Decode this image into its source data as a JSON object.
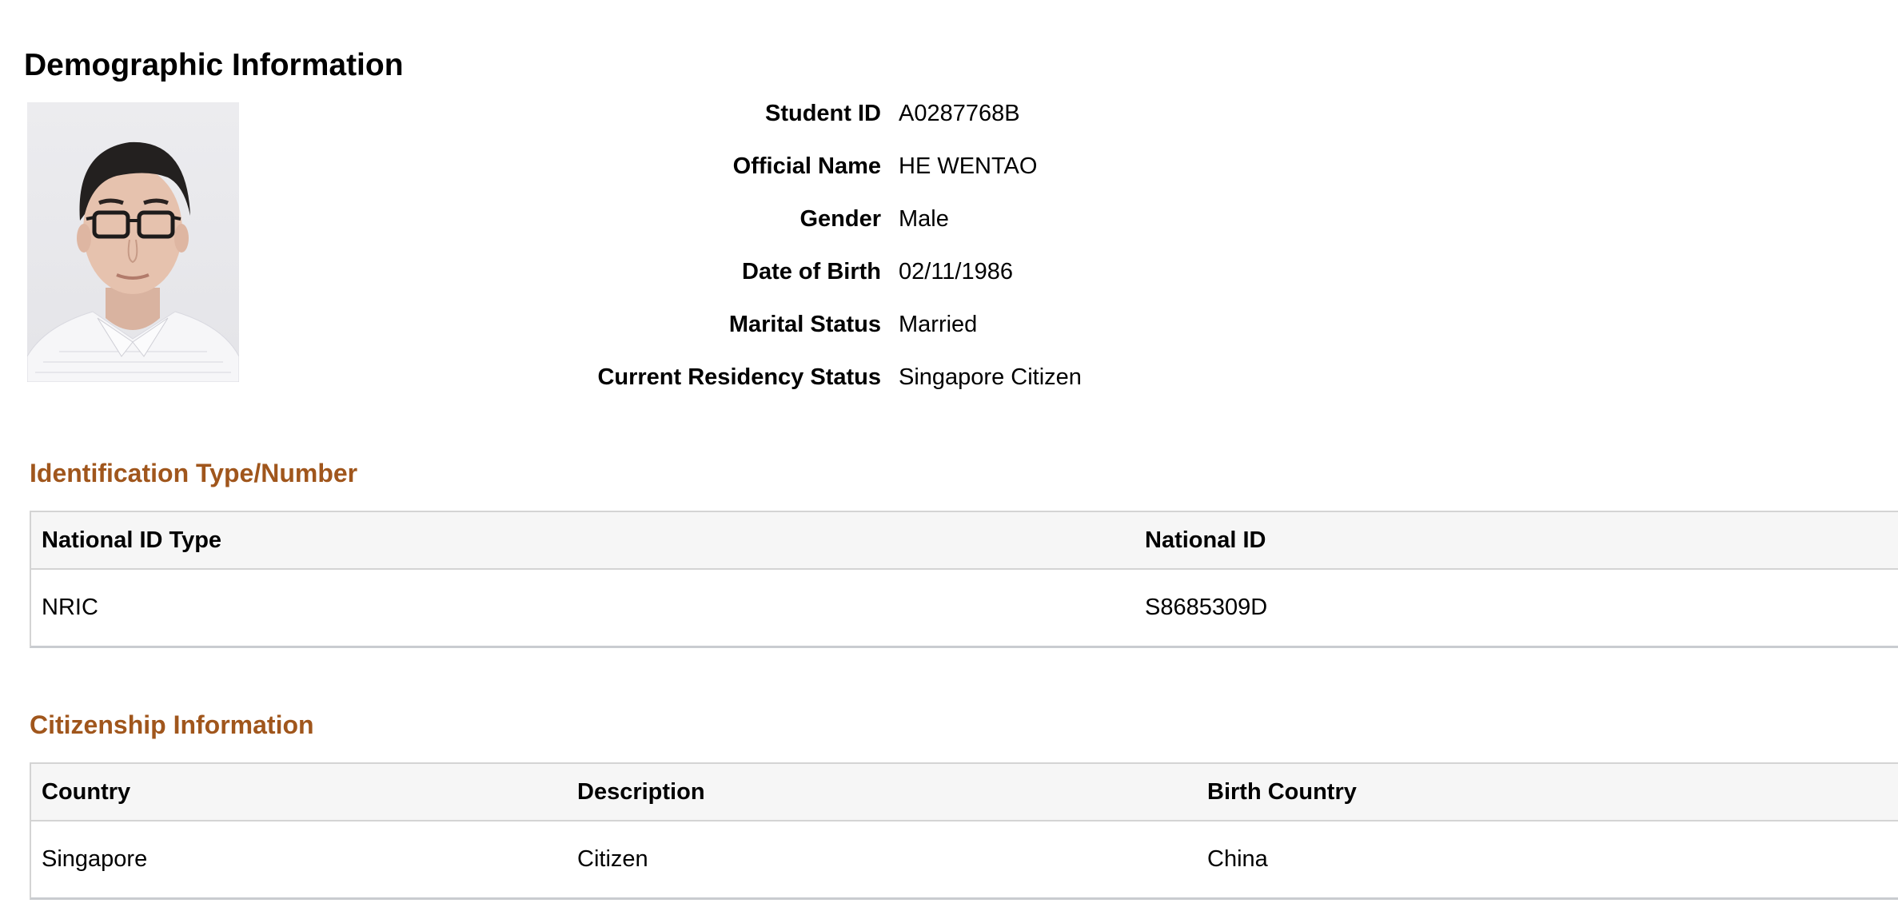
{
  "page": {
    "title": "Demographic Information"
  },
  "photo": {
    "alt": "Student photo"
  },
  "demographics": {
    "fields": [
      {
        "label": "Student ID",
        "value": "A0287768B"
      },
      {
        "label": "Official Name",
        "value": "HE WENTAO"
      },
      {
        "label": "Gender",
        "value": "Male"
      },
      {
        "label": "Date of Birth",
        "value": "02/11/1986"
      },
      {
        "label": "Marital Status",
        "value": "Married"
      },
      {
        "label": "Current Residency Status",
        "value": "Singapore Citizen"
      }
    ]
  },
  "identification": {
    "title": "Identification Type/Number",
    "columns": [
      "National ID Type",
      "National ID"
    ],
    "rows": [
      [
        "NRIC",
        "S8685309D"
      ]
    ]
  },
  "citizenship": {
    "title": "Citizenship Information",
    "columns": [
      "Country",
      "Description",
      "Birth Country"
    ],
    "rows": [
      [
        "Singapore",
        "Citizen",
        "China"
      ]
    ]
  }
}
